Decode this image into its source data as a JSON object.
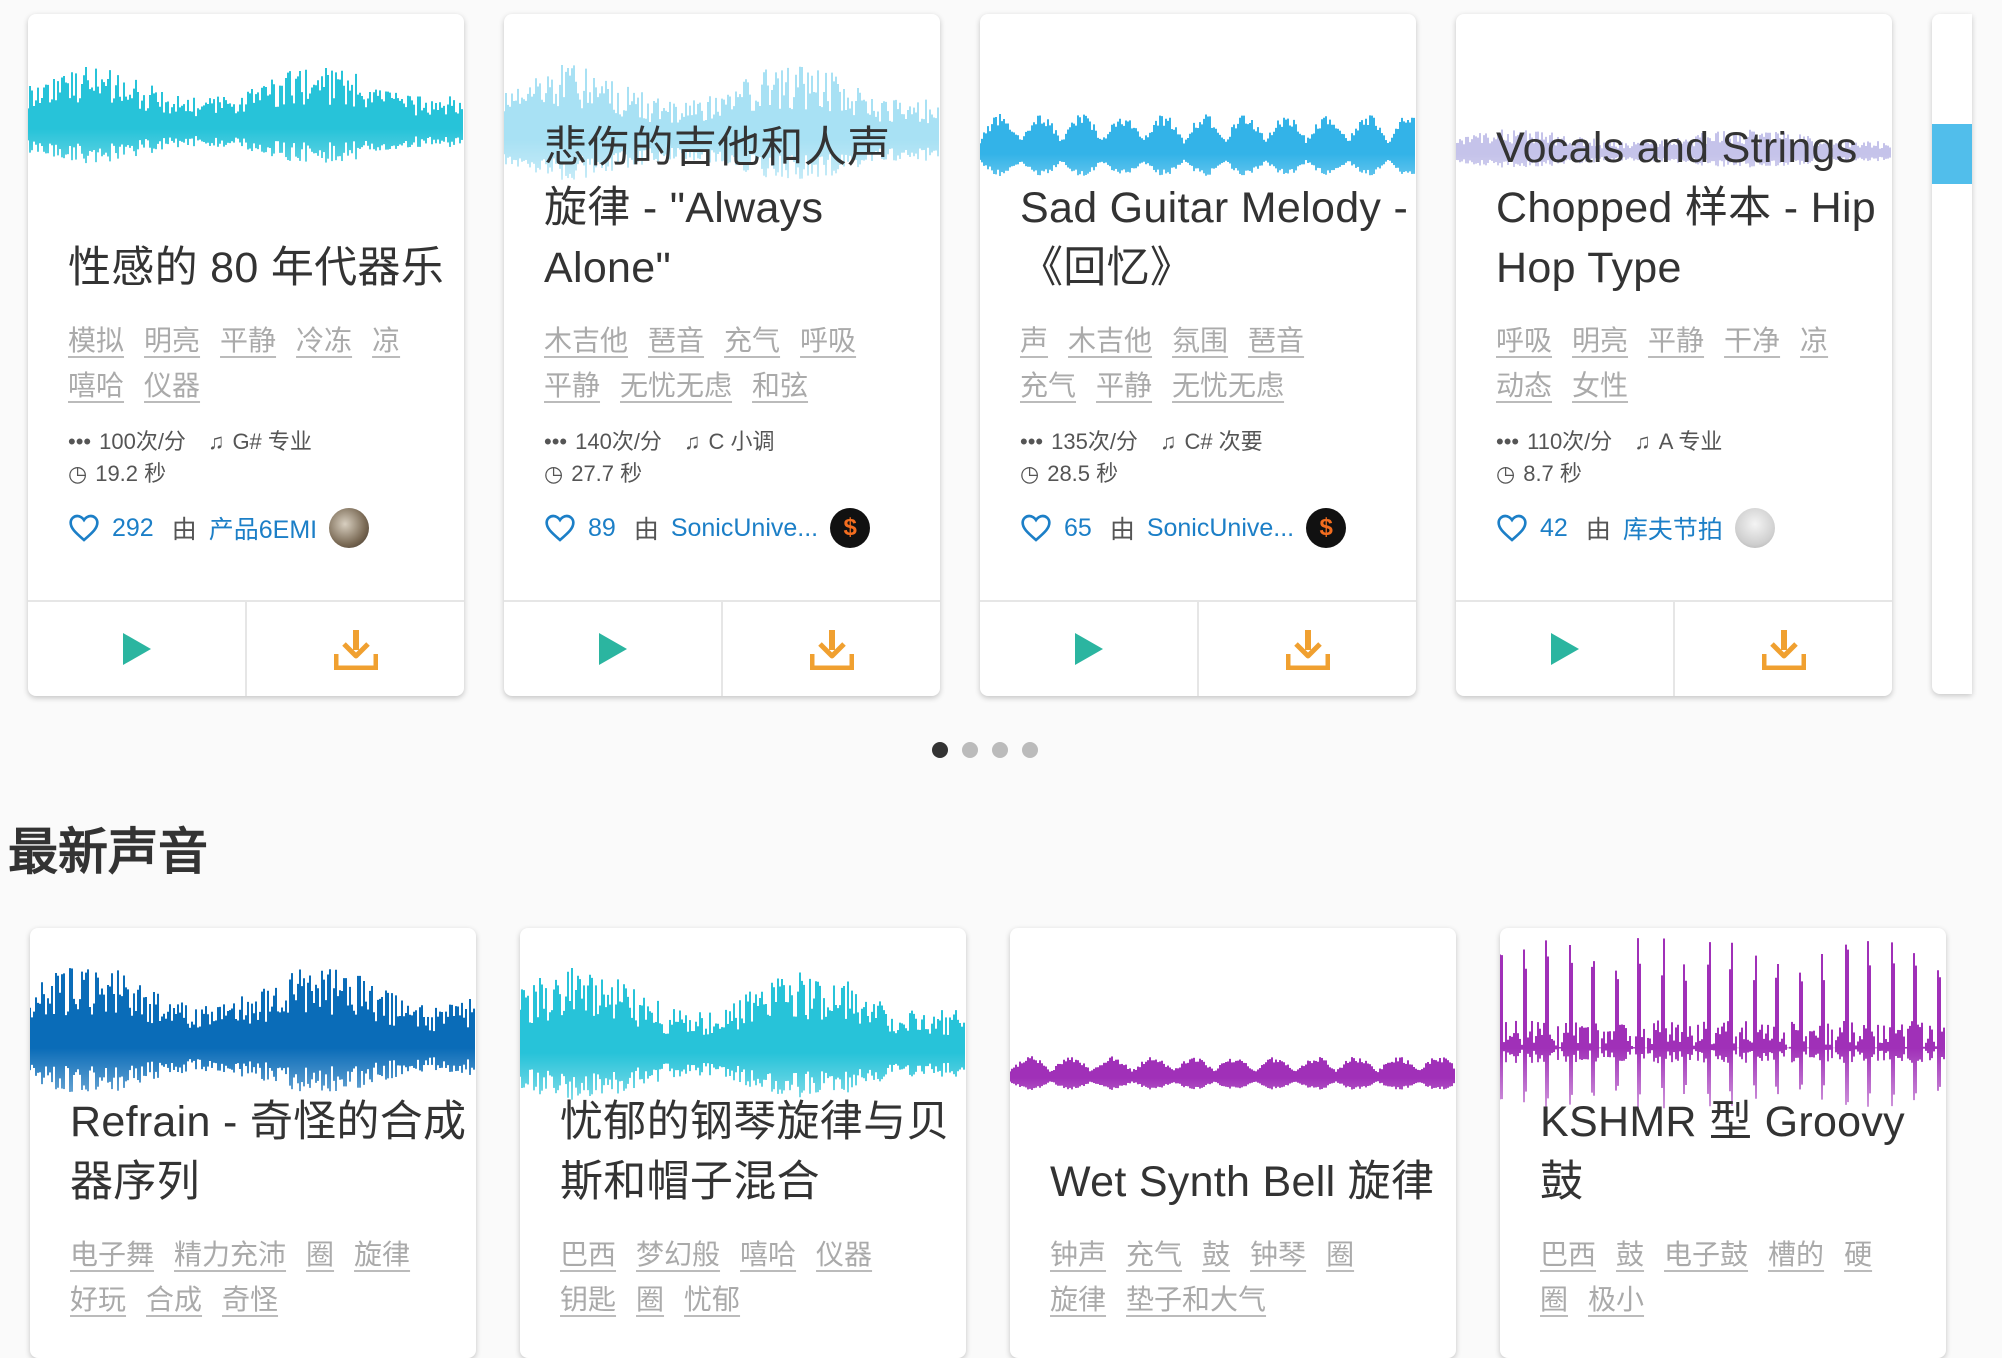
{
  "carousel": {
    "cards": [
      {
        "title_lines": [
          "性感的 80 年代器乐"
        ],
        "tags": [
          "模拟",
          "明亮",
          "平静",
          "冷冻",
          "凉",
          "嘻哈",
          "仪器"
        ],
        "bpm": "100次/分",
        "key": "G# 专业",
        "duration": "19.2 秒",
        "likes": "292",
        "by": "由",
        "author": "产品6EMI",
        "wave_color": "#27c3d9"
      },
      {
        "title_lines": [
          "悲伤的吉他和人声",
          "旋律 - \"Always",
          "Alone\""
        ],
        "tags": [
          "木吉他",
          "琶音",
          "充气",
          "呼吸",
          "平静",
          "无忧无虑",
          "和弦"
        ],
        "bpm": "140次/分",
        "key": "C 小调",
        "duration": "27.7 秒",
        "likes": "89",
        "by": "由",
        "author": "SonicUnive...",
        "wave_color": "#a8e1f4"
      },
      {
        "title_lines": [
          "Sad Guitar Melody -",
          "《回忆》"
        ],
        "tags": [
          "声",
          "木吉他",
          "氛围",
          "琶音",
          "充气",
          "平静",
          "无忧无虑"
        ],
        "bpm": "135次/分",
        "key": "C# 次要",
        "duration": "28.5 秒",
        "likes": "65",
        "by": "由",
        "author": "SonicUnive...",
        "wave_color": "#33b3e8"
      },
      {
        "title_lines": [
          "Vocals and Strings",
          "Chopped 样本 - Hip",
          "Hop Type"
        ],
        "tags": [
          "呼吸",
          "明亮",
          "平静",
          "干净",
          "凉",
          "动态",
          "女性"
        ],
        "bpm": "110次/分",
        "key": "A 专业",
        "duration": "8.7 秒",
        "likes": "42",
        "by": "由",
        "author": "库夫节拍",
        "wave_color": "#c5c3ea"
      }
    ],
    "page_count": 4,
    "active_page": 1
  },
  "latest": {
    "heading": "最新声音",
    "cards": [
      {
        "title_lines": [
          "Refrain - 奇怪的合成",
          "器序列"
        ],
        "tags": [
          "电子舞",
          "精力充沛",
          "圈",
          "旋律",
          "好玩",
          "合成",
          "奇怪"
        ],
        "wave_color": "#0a6cb8"
      },
      {
        "title_lines": [
          "忧郁的钢琴旋律与贝",
          "斯和帽子混合"
        ],
        "tags": [
          "巴西",
          "梦幻般",
          "嘻哈",
          "仪器",
          "钥匙",
          "圈",
          "忧郁"
        ],
        "wave_color": "#27c3d9"
      },
      {
        "title_lines": [
          "Wet Synth Bell 旋律"
        ],
        "tags": [
          "钟声",
          "充气",
          "鼓",
          "钟琴",
          "圈",
          "旋律",
          "垫子和大气"
        ],
        "wave_color": "#a030b8"
      },
      {
        "title_lines": [
          "KSHMR 型 Groovy",
          "鼓"
        ],
        "tags": [
          "巴西",
          "鼓",
          "电子鼓",
          "槽的",
          "硬",
          "圈",
          "极小"
        ],
        "wave_color": "#a030b8"
      }
    ]
  },
  "colors": {
    "link": "#1c7fc7",
    "play": "#2bb5a0",
    "download": "#f0a030"
  }
}
